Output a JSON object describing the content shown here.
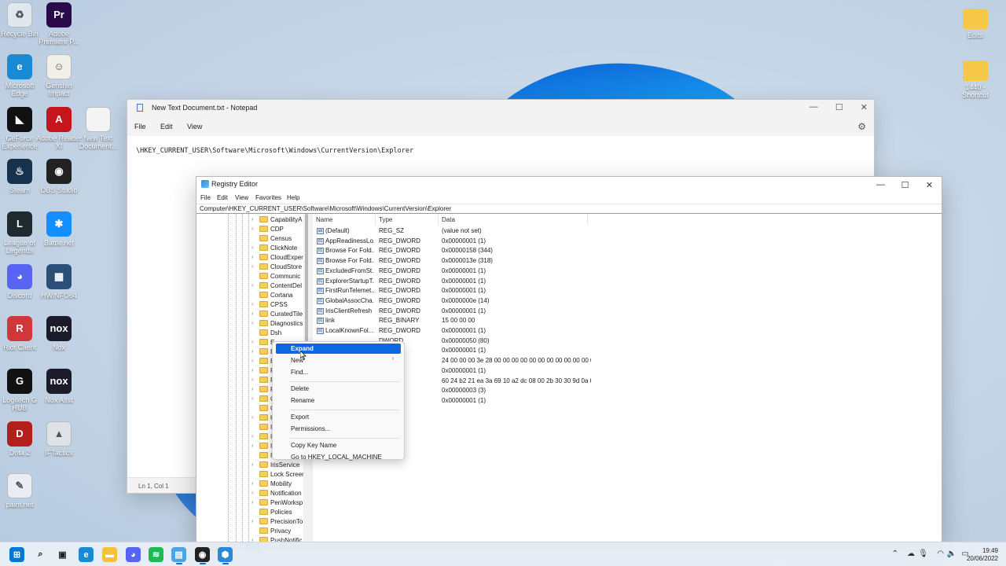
{
  "desktop": {
    "left_icons": [
      {
        "label": "Recycle Bin",
        "icon": "recycle-bin-icon",
        "color": "#dfe7ef",
        "glyph": "♻"
      },
      {
        "label": "Adobe Premiere P...",
        "icon": "premiere-pro-icon",
        "color": "#2a0a4a",
        "glyph": "Pr"
      },
      {
        "label": "Microsoft Edge",
        "icon": "edge-icon",
        "color": "#1a8ad4",
        "glyph": "e"
      },
      {
        "label": "Genshin Impact",
        "icon": "genshin-icon",
        "color": "#f1efe9",
        "glyph": "☺"
      },
      {
        "label": "GeForce Experience",
        "icon": "geforce-icon",
        "color": "#111111",
        "glyph": "◣"
      },
      {
        "label": "Adobe Reader XI",
        "icon": "adobe-reader-icon",
        "color": "#c4161c",
        "glyph": "A"
      },
      {
        "label": "New Text Document...",
        "icon": "text-document-icon",
        "color": "#f4f4f4",
        "glyph": ""
      },
      {
        "label": "Steam",
        "icon": "steam-icon",
        "color": "#17324d",
        "glyph": "♨"
      },
      {
        "label": "OBS Studio",
        "icon": "obs-icon",
        "color": "#222222",
        "glyph": "◉"
      },
      {
        "label": "League of Legends",
        "icon": "league-icon",
        "color": "#1d2a2e",
        "glyph": "L"
      },
      {
        "label": "Battle.net",
        "icon": "battlenet-icon",
        "color": "#148eff",
        "glyph": "✱"
      },
      {
        "label": "Discord",
        "icon": "discord-icon",
        "color": "#5865f2",
        "glyph": "◕"
      },
      {
        "label": "HWiNFO64",
        "icon": "hwinfo-icon",
        "color": "#2c4f79",
        "glyph": "▦"
      },
      {
        "label": "Riot Client",
        "icon": "riot-icon",
        "color": "#d13639",
        "glyph": "R"
      },
      {
        "label": "Nox",
        "icon": "nox-icon",
        "color": "#1b1b2a",
        "glyph": "nox"
      },
      {
        "label": "Logitech G HUB",
        "icon": "logitech-icon",
        "color": "#111111",
        "glyph": "G"
      },
      {
        "label": "Nox Asst",
        "icon": "nox-asst-icon",
        "color": "#1b1b2a",
        "glyph": "nox"
      },
      {
        "label": "Dota 2",
        "icon": "dota-icon",
        "color": "#b3201b",
        "glyph": "D"
      },
      {
        "label": "IFTactics",
        "icon": "tactics-icon",
        "color": "#dfe3e8",
        "glyph": "▲"
      },
      {
        "label": "paint.net",
        "icon": "paintnet-icon",
        "color": "#e9eef5",
        "glyph": "✎"
      }
    ],
    "right_icons": [
      {
        "label": "Edits",
        "icon": "folder-icon"
      },
      {
        "label": "1440 - Shortcut",
        "icon": "folder-shortcut-icon"
      }
    ]
  },
  "notepad": {
    "title": "New Text Document.txt - Notepad",
    "menu": [
      "File",
      "Edit",
      "View"
    ],
    "content": "\\HKEY_CURRENT_USER\\Software\\Microsoft\\Windows\\CurrentVersion\\Explorer",
    "status": "Ln 1, Col 1"
  },
  "regedit": {
    "title": "Registry Editor",
    "menu": [
      "File",
      "Edit",
      "View",
      "Favorites",
      "Help"
    ],
    "address": "Computer\\HKEY_CURRENT_USER\\Software\\Microsoft\\Windows\\CurrentVersion\\Explorer",
    "tree_items": [
      {
        "label": "CapabilityA",
        "expandable": true
      },
      {
        "label": "CDP",
        "expandable": true
      },
      {
        "label": "Census",
        "expandable": false
      },
      {
        "label": "ClickNote",
        "expandable": true
      },
      {
        "label": "CloudExper",
        "expandable": true
      },
      {
        "label": "CloudStore",
        "expandable": true
      },
      {
        "label": "Communic",
        "expandable": false
      },
      {
        "label": "ContentDel",
        "expandable": true
      },
      {
        "label": "Cortana",
        "expandable": false
      },
      {
        "label": "CPSS",
        "expandable": true
      },
      {
        "label": "CuratedTile",
        "expandable": true
      },
      {
        "label": "Diagnostics",
        "expandable": true
      },
      {
        "label": "Dsh",
        "expandable": false
      },
      {
        "label": "E",
        "expandable": true
      },
      {
        "label": "E",
        "expandable": true
      },
      {
        "label": "E",
        "expandable": true
      },
      {
        "label": "F",
        "expandable": true
      },
      {
        "label": "F",
        "expandable": true
      },
      {
        "label": "F",
        "expandable": true
      },
      {
        "label": "G",
        "expandable": true
      },
      {
        "label": "G",
        "expandable": false
      },
      {
        "label": "H",
        "expandable": true
      },
      {
        "label": "I",
        "expandable": false
      },
      {
        "label": "I",
        "expandable": true
      },
      {
        "label": "I",
        "expandable": true
      },
      {
        "label": "I",
        "expandable": false
      },
      {
        "label": "IrisService",
        "expandable": true
      },
      {
        "label": "Lock Screen",
        "expandable": false
      },
      {
        "label": "Mobility",
        "expandable": true
      },
      {
        "label": "Notification",
        "expandable": true
      },
      {
        "label": "PenWorksp",
        "expandable": true
      },
      {
        "label": "Policies",
        "expandable": false
      },
      {
        "label": "PrecisionTo",
        "expandable": true
      },
      {
        "label": "Privacy",
        "expandable": false
      },
      {
        "label": "PushNotific",
        "expandable": true
      }
    ],
    "columns": [
      "Name",
      "Type",
      "Data"
    ],
    "values": [
      {
        "name": "(Default)",
        "type": "REG_SZ",
        "data": "(value not set)",
        "kind": "ab"
      },
      {
        "name": "AppReadinessLo...",
        "type": "REG_DWORD",
        "data": "0x00000001 (1)",
        "kind": "01"
      },
      {
        "name": "Browse For Fold...",
        "type": "REG_DWORD",
        "data": "0x00000158 (344)",
        "kind": "01"
      },
      {
        "name": "Browse For Fold...",
        "type": "REG_DWORD",
        "data": "0x0000013e (318)",
        "kind": "01"
      },
      {
        "name": "ExcludedFromSt...",
        "type": "REG_DWORD",
        "data": "0x00000001 (1)",
        "kind": "01"
      },
      {
        "name": "ExplorerStartupT...",
        "type": "REG_DWORD",
        "data": "0x00000001 (1)",
        "kind": "01"
      },
      {
        "name": "FirstRunTelemet...",
        "type": "REG_DWORD",
        "data": "0x00000001 (1)",
        "kind": "01"
      },
      {
        "name": "GlobalAssocCha...",
        "type": "REG_DWORD",
        "data": "0x0000000e (14)",
        "kind": "01"
      },
      {
        "name": "IrisClientRefresh",
        "type": "REG_DWORD",
        "data": "0x00000001 (1)",
        "kind": "01"
      },
      {
        "name": "link",
        "type": "REG_BINARY",
        "data": "15 00 00 00",
        "kind": "01"
      },
      {
        "name": "LocalKnownFol...",
        "type": "REG_DWORD",
        "data": "0x00000001 (1)",
        "kind": "01"
      },
      {
        "name": "",
        "type": "DWORD",
        "data": "0x00000050 (80)",
        "kind": "01"
      },
      {
        "name": "",
        "type": "DWORD",
        "data": "0x00000001 (1)",
        "kind": "01"
      },
      {
        "name": "",
        "type": "RY",
        "data": "24 00 00 00 3e 28 00 00 00 00 00 00 00 00 00 00 00 00...",
        "kind": "01"
      },
      {
        "name": "",
        "type": "DWORD",
        "data": "0x00000001 (1)",
        "kind": "01"
      },
      {
        "name": "",
        "type": "RY",
        "data": "60 24 b2 21 ea 3a 69 10 a2 dc 08 00 2b 30 30 9d 0a 0...",
        "kind": "01"
      },
      {
        "name": "",
        "type": "DWORD",
        "data": "0x00000003 (3)",
        "kind": "01"
      },
      {
        "name": "",
        "type": "DWORD",
        "data": "0x00000001 (1)",
        "kind": "01"
      }
    ]
  },
  "context_menu": {
    "items": [
      {
        "label": "Expand",
        "selected": true,
        "submenu": false
      },
      {
        "label": "New",
        "selected": false,
        "submenu": true
      },
      {
        "label": "Find...",
        "selected": false,
        "submenu": false
      },
      {
        "sep": true
      },
      {
        "label": "Delete",
        "selected": false,
        "submenu": false
      },
      {
        "label": "Rename",
        "selected": false,
        "submenu": false
      },
      {
        "sep": true
      },
      {
        "label": "Export",
        "selected": false,
        "submenu": false
      },
      {
        "label": "Permissions...",
        "selected": false,
        "submenu": false
      },
      {
        "sep": true
      },
      {
        "label": "Copy Key Name",
        "selected": false,
        "submenu": false
      },
      {
        "label": "Go to HKEY_LOCAL_MACHINE",
        "selected": false,
        "submenu": false
      }
    ]
  },
  "taskbar": {
    "apps": [
      {
        "icon": "windows-start-icon",
        "color": "#0078d4",
        "glyph": "⊞"
      },
      {
        "icon": "search-icon",
        "color": "transparent",
        "glyph": "⌕"
      },
      {
        "icon": "task-view-icon",
        "color": "transparent",
        "glyph": "▣"
      },
      {
        "icon": "edge-icon",
        "color": "#1a8ad4",
        "glyph": "e"
      },
      {
        "icon": "file-explorer-icon",
        "color": "#f3c13a",
        "glyph": "▬"
      },
      {
        "icon": "discord-icon",
        "color": "#5865f2",
        "glyph": "◕"
      },
      {
        "icon": "spotify-icon",
        "color": "#1db954",
        "glyph": "≋"
      },
      {
        "icon": "notepad-icon",
        "color": "#4fa3e0",
        "glyph": "▤"
      },
      {
        "icon": "obs-icon",
        "color": "#222222",
        "glyph": "◉"
      },
      {
        "icon": "regedit-icon",
        "color": "#2b88d8",
        "glyph": "⬢"
      }
    ],
    "tray": [
      "chevron-up-icon",
      "onedrive-icon",
      "microphone-icon",
      "wifi-icon",
      "speaker-icon",
      "battery-icon"
    ],
    "time": "19:49",
    "date": "20/06/2022"
  }
}
